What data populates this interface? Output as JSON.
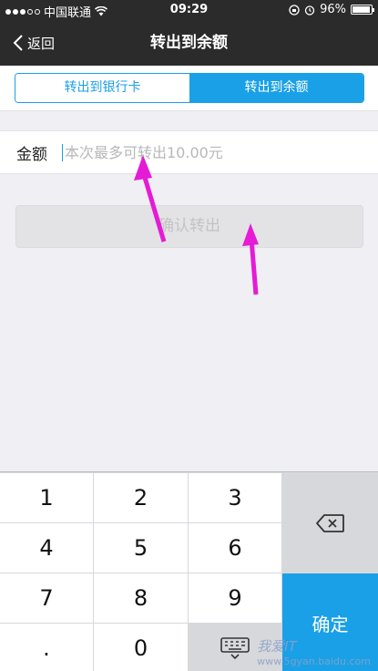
{
  "status_bar": {
    "carrier": "中国联通",
    "time": "09:29",
    "battery": "96%",
    "battery_level": 0.96
  },
  "nav": {
    "back_label": "返回",
    "title": "转出到余额"
  },
  "tabs": [
    {
      "label": "转出到银行卡",
      "active": false
    },
    {
      "label": "转出到余额",
      "active": true
    }
  ],
  "amount": {
    "label": "金额",
    "placeholder": "本次最多可转出10.00元",
    "value": ""
  },
  "confirm_button": "确认转出",
  "keypad": {
    "rows": [
      [
        "1",
        "2",
        "3"
      ],
      [
        "4",
        "5",
        "6"
      ],
      [
        "7",
        "8",
        "9"
      ],
      [
        ".",
        "0",
        ""
      ]
    ],
    "done_label": "确定",
    "icons": {
      "backspace": "backspace-icon",
      "hide": "keyboard-hide-icon"
    }
  },
  "watermark": {
    "line1": "我爱IT",
    "line2": "www.5gyan.baidu.com"
  },
  "colors": {
    "accent": "#1aa0e6",
    "header": "#2b2b2b",
    "arrow": "#e51bd6"
  }
}
